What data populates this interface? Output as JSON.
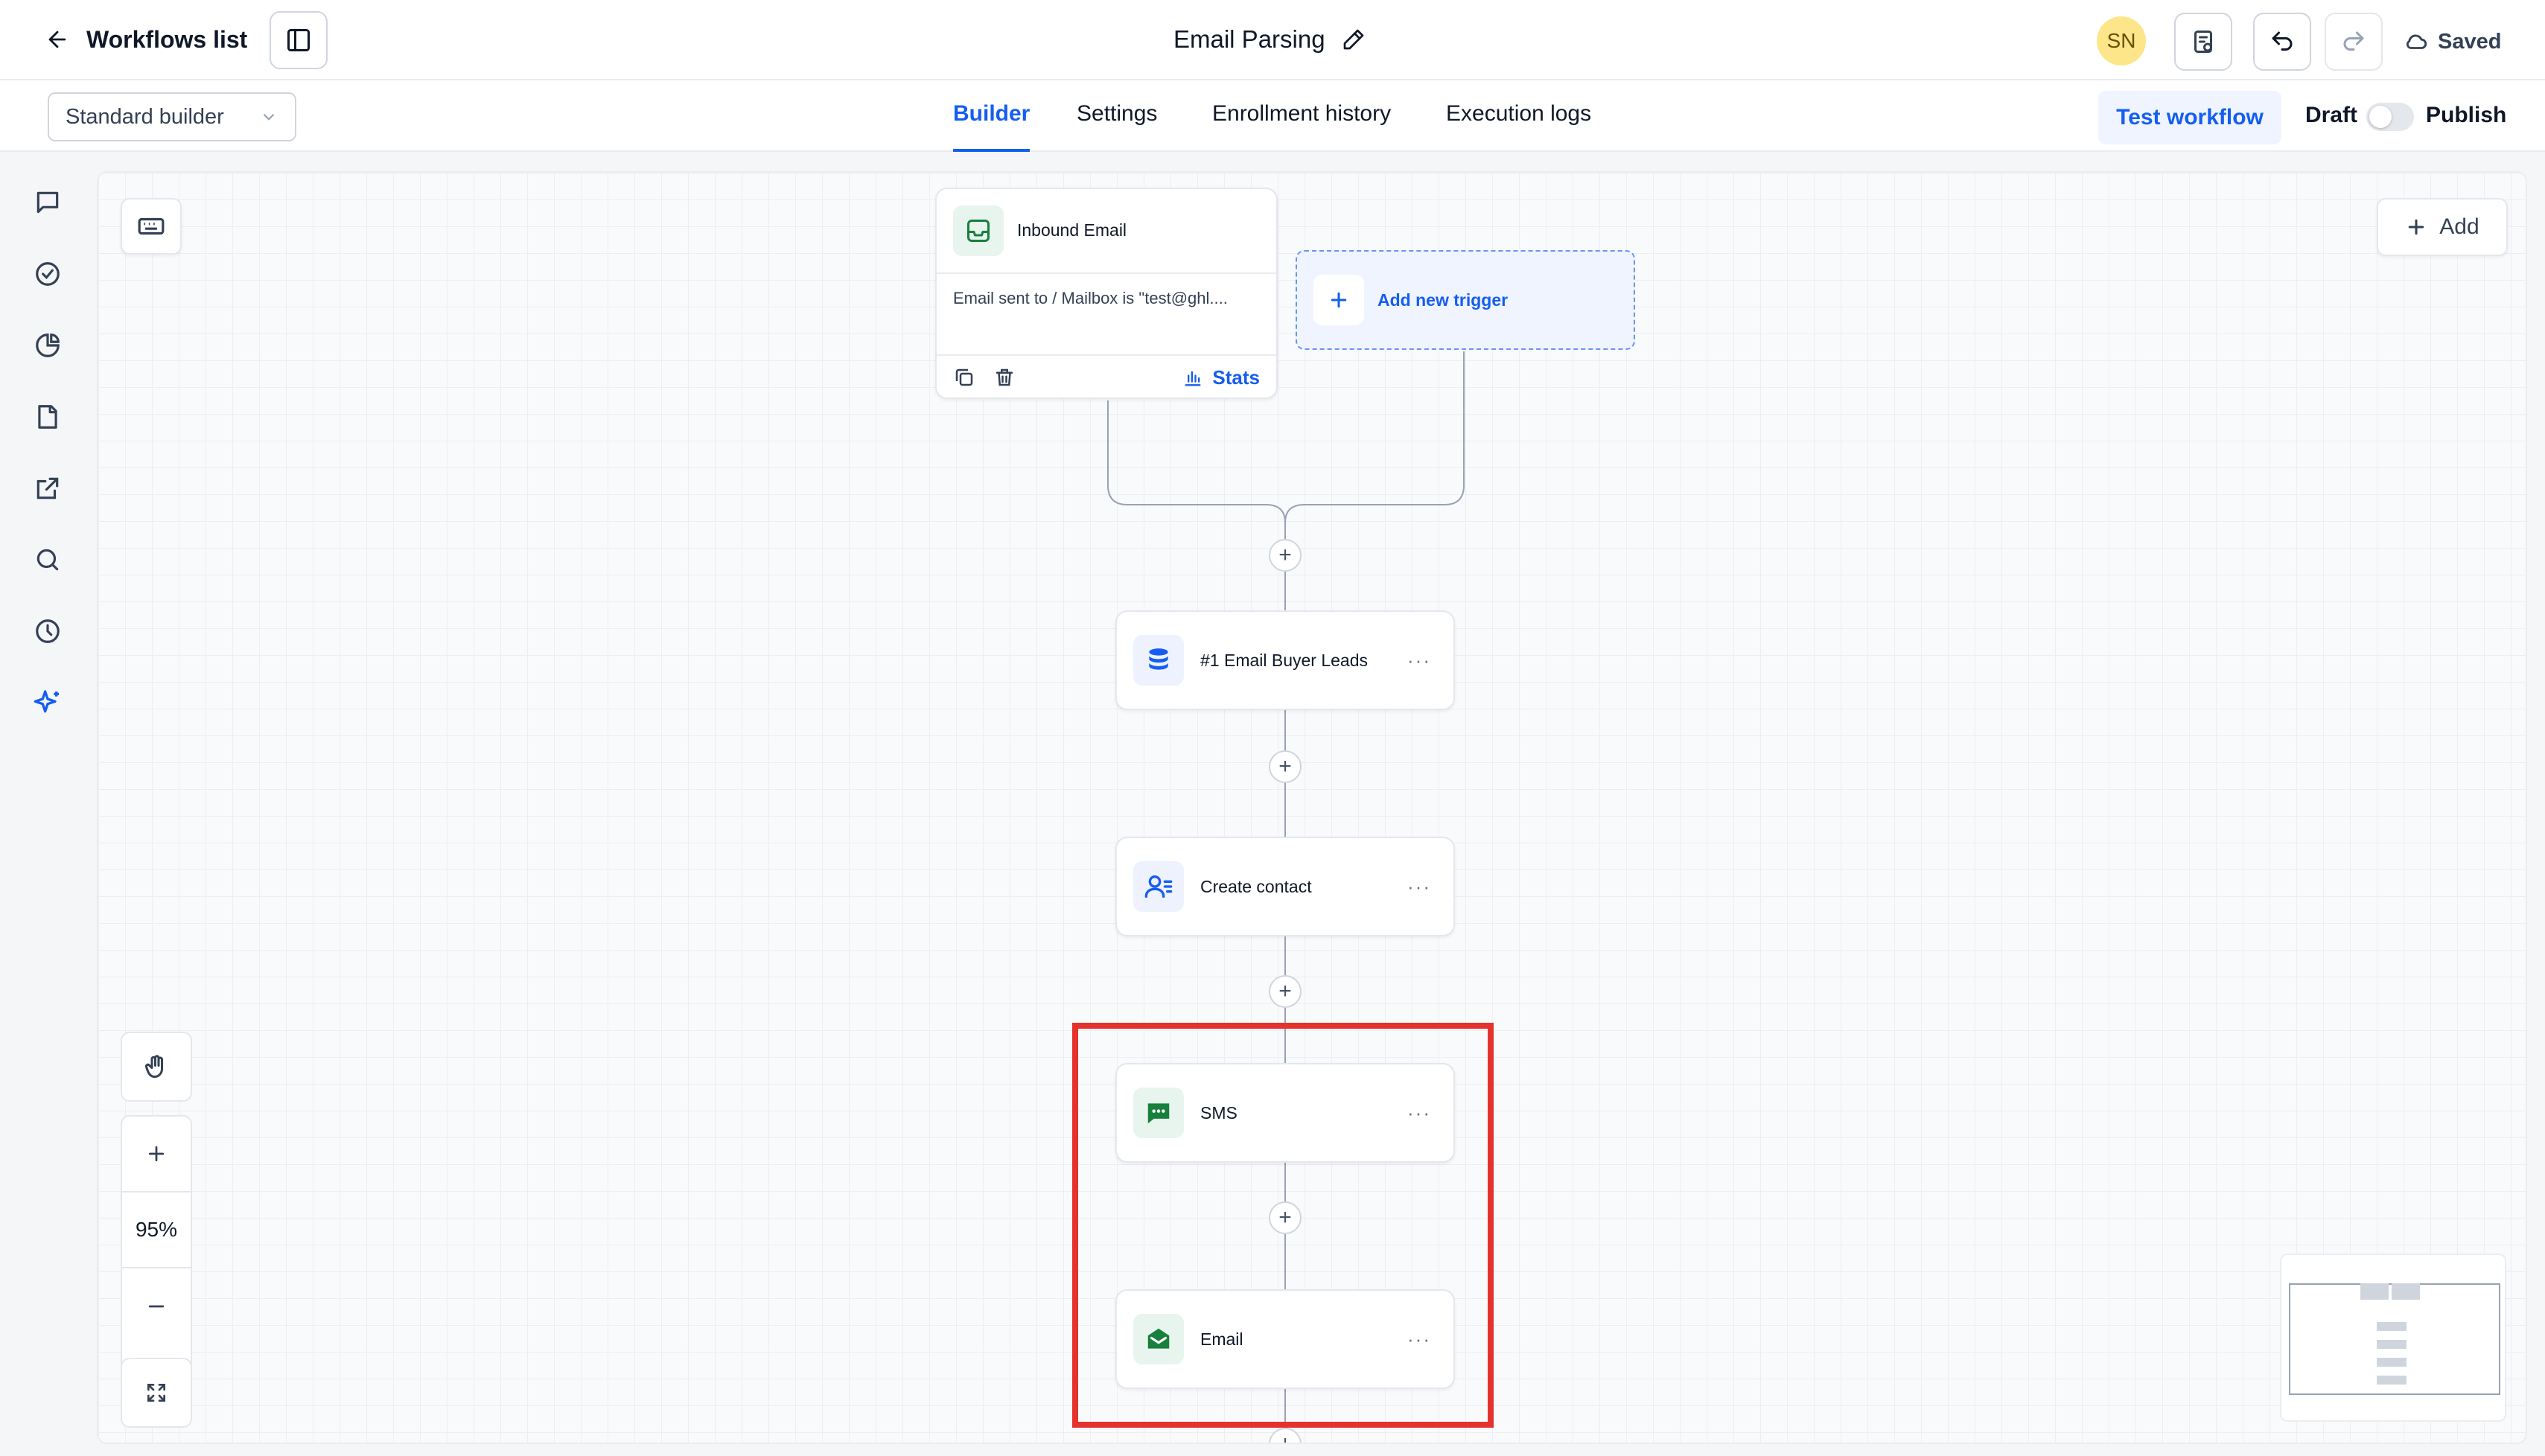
{
  "header": {
    "back_label": "Workflows list",
    "workflow_title": "Email Parsing",
    "avatar_initials": "SN",
    "saved_label": "Saved"
  },
  "subbar": {
    "builder_select_value": "Standard builder",
    "tabs": [
      {
        "label": "Builder",
        "active": true
      },
      {
        "label": "Settings",
        "active": false
      },
      {
        "label": "Enrollment history",
        "active": false
      },
      {
        "label": "Execution logs",
        "active": false
      }
    ],
    "test_button": "Test workflow",
    "draft_label": "Draft",
    "publish_label": "Publish",
    "publish_toggle_on": false
  },
  "rail": {
    "icons": [
      "chat-icon",
      "check-circle-icon",
      "pie-chart-icon",
      "document-icon",
      "external-link-icon",
      "search-icon",
      "history-icon",
      "sparkle-icon"
    ]
  },
  "canvas": {
    "add_button": "Add",
    "trigger": {
      "title": "Inbound Email",
      "description": "Email sent to / Mailbox is \"test@ghl....",
      "stats_label": "Stats"
    },
    "add_trigger_label": "Add new trigger",
    "actions": [
      {
        "label": "#1 Email Buyer Leads",
        "icon": "database-icon"
      },
      {
        "label": "Create contact",
        "icon": "user-list-icon"
      },
      {
        "label": "SMS",
        "icon": "sms-icon"
      },
      {
        "label": "Email",
        "icon": "envelope-icon"
      }
    ],
    "zoom_level": "95%"
  },
  "colors": {
    "accent": "#155eef",
    "highlight_box": "#e5322d",
    "green_icon": "#16803c"
  }
}
